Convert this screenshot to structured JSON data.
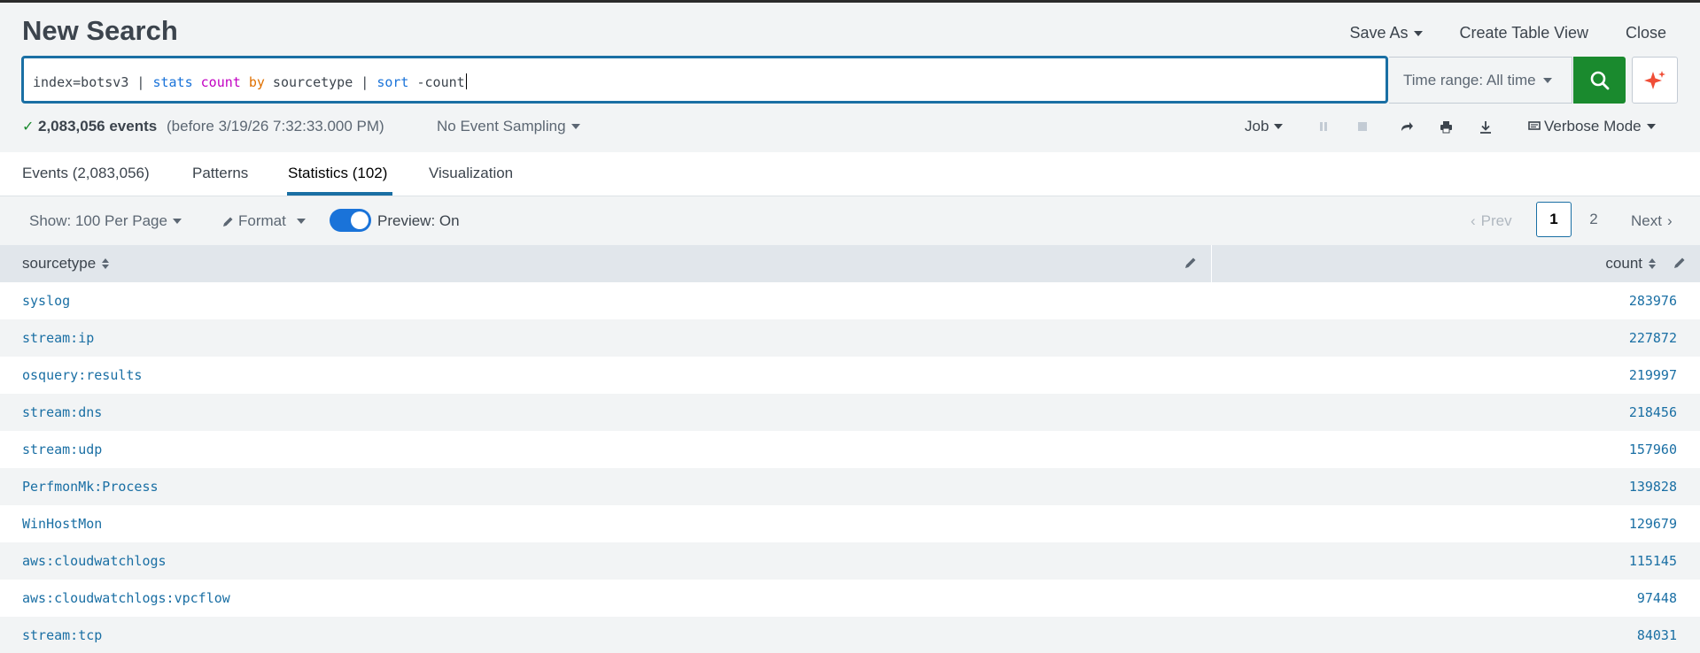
{
  "header": {
    "title": "New Search",
    "save_as": "Save As",
    "create_table_view": "Create Table View",
    "close": "Close"
  },
  "search": {
    "parts": [
      {
        "text": "index=botsv3 | ",
        "cls": ""
      },
      {
        "text": "stats",
        "cls": "cmd"
      },
      {
        "text": " ",
        "cls": ""
      },
      {
        "text": "count",
        "cls": "fn"
      },
      {
        "text": " ",
        "cls": ""
      },
      {
        "text": "by",
        "cls": "kw"
      },
      {
        "text": " sourcetype | ",
        "cls": ""
      },
      {
        "text": "sort",
        "cls": "cmd"
      },
      {
        "text": " -count",
        "cls": ""
      }
    ],
    "time_range": "Time range: All time"
  },
  "status": {
    "events": "2,083,056 events",
    "before": "(before 3/19/26 7:32:33.000 PM)",
    "sampling": "No Event Sampling",
    "job": "Job",
    "mode": "Verbose Mode"
  },
  "tabs": [
    {
      "label": "Events (2,083,056)"
    },
    {
      "label": "Patterns"
    },
    {
      "label": "Statistics (102)"
    },
    {
      "label": "Visualization"
    }
  ],
  "toolbar": {
    "show": "Show: 100 Per Page",
    "format": "Format",
    "preview": "Preview: On",
    "prev": "Prev",
    "pages": [
      "1",
      "2"
    ],
    "next": "Next"
  },
  "table": {
    "columns": [
      "sourcetype",
      "count"
    ],
    "rows": [
      [
        "syslog",
        "283976"
      ],
      [
        "stream:ip",
        "227872"
      ],
      [
        "osquery:results",
        "219997"
      ],
      [
        "stream:dns",
        "218456"
      ],
      [
        "stream:udp",
        "157960"
      ],
      [
        "PerfmonMk:Process",
        "139828"
      ],
      [
        "WinHostMon",
        "129679"
      ],
      [
        "aws:cloudwatchlogs",
        "115145"
      ],
      [
        "aws:cloudwatchlogs:vpcflow",
        "97448"
      ],
      [
        "stream:tcp",
        "84031"
      ]
    ]
  },
  "colors": {
    "accent": "#1a6fa4",
    "search_button": "#1a8a2e",
    "ai_icon": "#f04e37"
  }
}
